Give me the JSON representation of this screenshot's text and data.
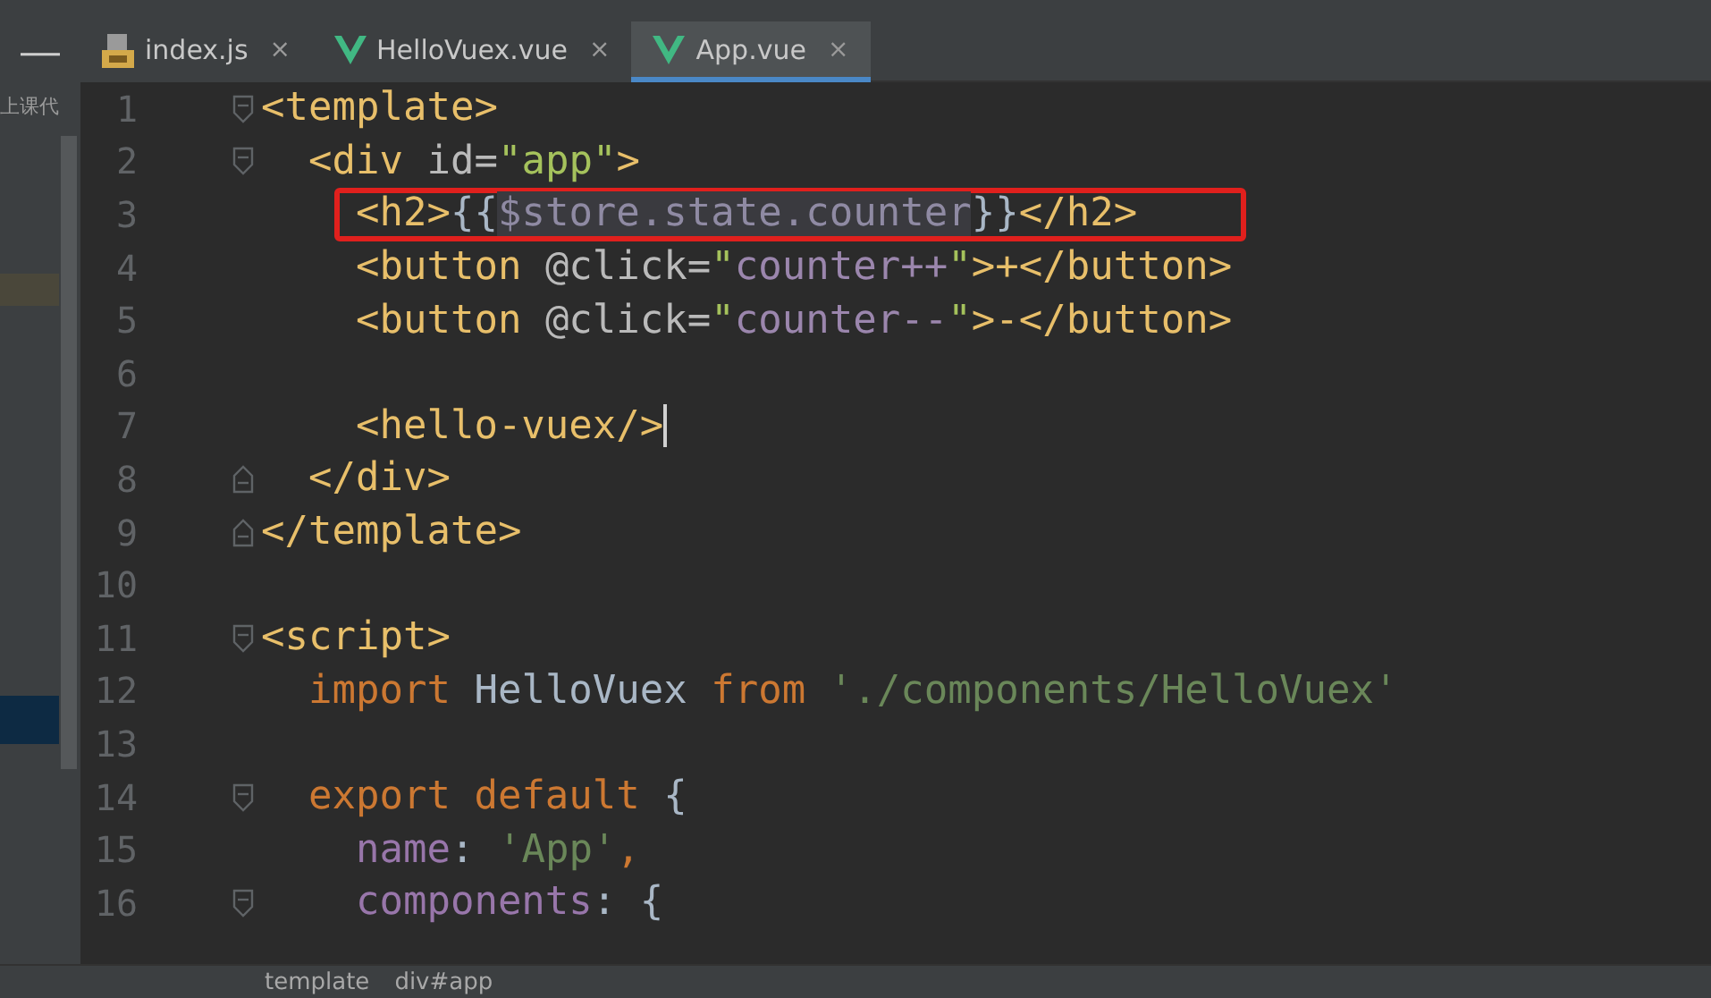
{
  "sidebar": {
    "label": "上课代"
  },
  "minimize_button": "—",
  "tabs": [
    {
      "label": "index.js",
      "kind": "js",
      "selected": false,
      "close": "×"
    },
    {
      "label": "HelloVuex.vue",
      "kind": "vue",
      "selected": false,
      "close": "×"
    },
    {
      "label": "App.vue",
      "kind": "vue",
      "selected": true,
      "close": "×"
    }
  ],
  "editor": {
    "lines": [
      {
        "number": "1",
        "fold_start": true,
        "fold_end": false,
        "highlighted": false,
        "cursor": false,
        "tokens": [
          {
            "kind": "tag",
            "text": "<template>"
          }
        ],
        "children": [
          {
            "number": "2",
            "fold_start": true,
            "fold_end": false,
            "highlighted": false,
            "cursor": false,
            "tokens": [
              {
                "kind": "tag",
                "text": "<div "
              },
              {
                "kind": "attr",
                "text": "id="
              },
              {
                "kind": "string",
                "text": "\"app\""
              },
              {
                "kind": "tag",
                "text": ">"
              }
            ],
            "children": [
              {
                "number": "3",
                "fold_start": false,
                "fold_end": false,
                "highlighted": true,
                "cursor": false,
                "tokens": [
                  {
                    "kind": "tag",
                    "text": "<h2>"
                  },
                  {
                    "kind": "plain",
                    "text": "{{"
                  },
                  {
                    "kind": "interp",
                    "text": "$store.state.counter"
                  },
                  {
                    "kind": "plain",
                    "text": "}}"
                  },
                  {
                    "kind": "tag",
                    "text": "</h2>"
                  }
                ]
              },
              {
                "number": "4",
                "fold_start": false,
                "fold_end": false,
                "highlighted": false,
                "cursor": false,
                "tokens": [
                  {
                    "kind": "tag",
                    "text": "<button "
                  },
                  {
                    "kind": "attr",
                    "text": "@click="
                  },
                  {
                    "kind": "string",
                    "text": "\""
                  },
                  {
                    "kind": "expr",
                    "text": "counter++"
                  },
                  {
                    "kind": "string",
                    "text": "\""
                  },
                  {
                    "kind": "tag",
                    "text": ">+</button>"
                  }
                ]
              },
              {
                "number": "5",
                "fold_start": false,
                "fold_end": false,
                "highlighted": false,
                "cursor": false,
                "tokens": [
                  {
                    "kind": "tag",
                    "text": "<button "
                  },
                  {
                    "kind": "attr",
                    "text": "@click="
                  },
                  {
                    "kind": "string",
                    "text": "\""
                  },
                  {
                    "kind": "expr",
                    "text": "counter--"
                  },
                  {
                    "kind": "string",
                    "text": "\""
                  },
                  {
                    "kind": "tag",
                    "text": ">-</button>"
                  }
                ]
              },
              {
                "number": "6",
                "fold_start": false,
                "fold_end": false,
                "highlighted": false,
                "cursor": false
              },
              {
                "number": "7",
                "fold_start": false,
                "fold_end": false,
                "highlighted": false,
                "cursor": true,
                "tokens": [
                  {
                    "kind": "tag",
                    "text": "<hello-vuex/>"
                  }
                ]
              }
            ]
          },
          {
            "number": "8",
            "fold_start": false,
            "fold_end": true,
            "highlighted": false,
            "cursor": false,
            "tokens": [
              {
                "kind": "tag",
                "text": "</div>"
              }
            ]
          }
        ]
      },
      {
        "number": "9",
        "fold_start": false,
        "fold_end": true,
        "highlighted": false,
        "cursor": false,
        "tokens": [
          {
            "kind": "tag",
            "text": "</template>"
          }
        ]
      },
      {
        "number": "10",
        "fold_start": false,
        "fold_end": false,
        "highlighted": false,
        "cursor": false
      },
      {
        "number": "11",
        "fold_start": true,
        "fold_end": false,
        "highlighted": false,
        "cursor": false,
        "tokens": [
          {
            "kind": "tag",
            "text": "<script>"
          }
        ],
        "children": [
          {
            "number": "12",
            "fold_start": false,
            "fold_end": false,
            "highlighted": false,
            "cursor": false,
            "tokens": [
              {
                "kind": "keyword",
                "text": "import "
              },
              {
                "kind": "plain",
                "text": "HelloVuex "
              },
              {
                "kind": "keyword",
                "text": "from "
              },
              {
                "kind": "jsstring",
                "text": "'./components/HelloVuex'"
              }
            ]
          },
          {
            "number": "13",
            "fold_start": false,
            "fold_end": false,
            "highlighted": false,
            "cursor": false
          },
          {
            "number": "14",
            "fold_start": true,
            "fold_end": false,
            "highlighted": false,
            "cursor": false,
            "tokens": [
              {
                "kind": "keyword",
                "text": "export default "
              },
              {
                "kind": "plain",
                "text": "{"
              }
            ],
            "children": [
              {
                "number": "15",
                "fold_start": false,
                "fold_end": false,
                "highlighted": false,
                "cursor": false,
                "tokens": [
                  {
                    "kind": "key",
                    "text": "name"
                  },
                  {
                    "kind": "plain",
                    "text": ": "
                  },
                  {
                    "kind": "jsstring",
                    "text": "'App'"
                  },
                  {
                    "kind": "keyword",
                    "text": ","
                  }
                ]
              },
              {
                "number": "16",
                "fold_start": true,
                "fold_end": false,
                "highlighted": false,
                "cursor": false,
                "tokens": [
                  {
                    "kind": "key",
                    "text": "components"
                  },
                  {
                    "kind": "plain",
                    "text": ": {"
                  }
                ]
              }
            ]
          }
        ]
      }
    ]
  },
  "breadcrumb": [
    "template",
    "div#app"
  ]
}
